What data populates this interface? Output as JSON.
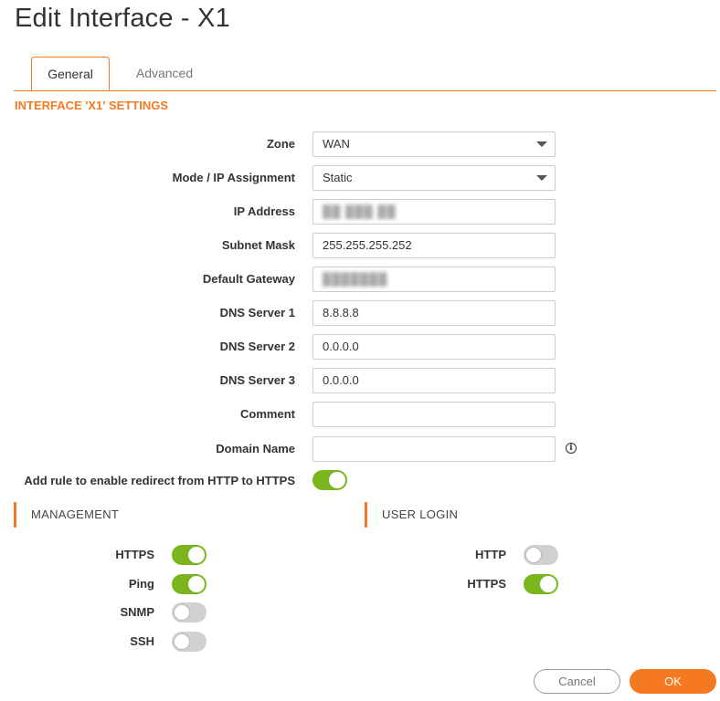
{
  "dialog": {
    "title": "Edit Interface - X1"
  },
  "tabs": [
    {
      "label": "General",
      "active": true
    },
    {
      "label": "Advanced",
      "active": false
    }
  ],
  "section": {
    "title": "INTERFACE 'X1' SETTINGS"
  },
  "form": {
    "zone": {
      "label": "Zone",
      "value": "WAN"
    },
    "mode": {
      "label": "Mode / IP Assignment",
      "value": "Static"
    },
    "ip_address": {
      "label": "IP Address",
      "value": ""
    },
    "subnet_mask": {
      "label": "Subnet Mask",
      "value": "255.255.255.252"
    },
    "default_gateway": {
      "label": "Default Gateway",
      "value": ""
    },
    "dns1": {
      "label": "DNS Server 1",
      "value": "8.8.8.8"
    },
    "dns2": {
      "label": "DNS Server 2",
      "value": "0.0.0.0"
    },
    "dns3": {
      "label": "DNS Server 3",
      "value": "0.0.0.0"
    },
    "comment": {
      "label": "Comment",
      "value": ""
    },
    "domain_name": {
      "label": "Domain Name",
      "value": ""
    },
    "redirect_rule": {
      "label": "Add rule to enable redirect from HTTP to HTTPS",
      "enabled": true
    }
  },
  "management": {
    "title": "MANAGEMENT",
    "items": [
      {
        "label": "HTTPS",
        "enabled": true
      },
      {
        "label": "Ping",
        "enabled": true
      },
      {
        "label": "SNMP",
        "enabled": false
      },
      {
        "label": "SSH",
        "enabled": false
      }
    ]
  },
  "user_login": {
    "title": "USER LOGIN",
    "items": [
      {
        "label": "HTTP",
        "enabled": false
      },
      {
        "label": "HTTPS",
        "enabled": true
      }
    ]
  },
  "buttons": {
    "cancel": "Cancel",
    "ok": "OK"
  },
  "icons": {
    "info": "info-icon",
    "dropdown": "chevron-down-icon"
  },
  "colors": {
    "accent": "#f47920",
    "toggle_on": "#7ab51d",
    "toggle_off": "#d0d0d0"
  }
}
